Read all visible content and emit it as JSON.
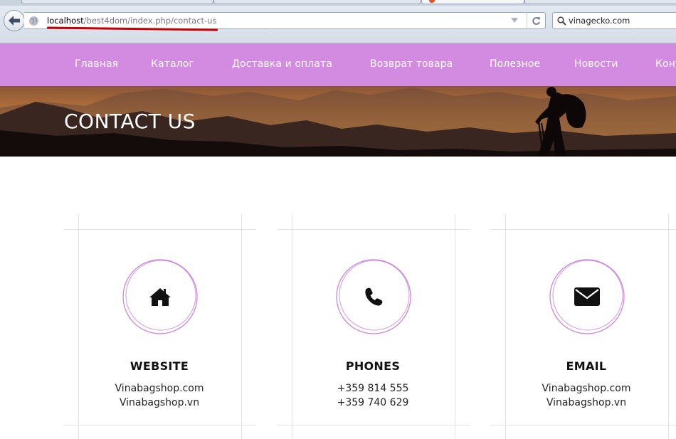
{
  "browser": {
    "url_host": "localhost",
    "url_path": "/best4dom/index.php/contact-us",
    "search_value": "vinagecko.com"
  },
  "nav": {
    "items": [
      "Главная",
      "Каталог",
      "Доставка и оплата",
      "Возврат товара",
      "Полезное",
      "Новости",
      "Конт"
    ]
  },
  "hero": {
    "title": "CONTACT US"
  },
  "contacts": [
    {
      "icon": "home-icon",
      "title": "WEBSITE",
      "line1": "Vinabagshop.com",
      "line2": "Vinabagshop.vn"
    },
    {
      "icon": "phone-icon",
      "title": "PHONES",
      "line1": "+359 814 555",
      "line2": "+359 740 629"
    },
    {
      "icon": "envelope-icon",
      "title": "EMAIL",
      "line1": "Vinabagshop.com",
      "line2": "Vinabagshop.vn"
    }
  ],
  "colors": {
    "nav_bg": "#d28be0",
    "accent_ring": "#c87fd8",
    "url_underline": "#c00000"
  }
}
